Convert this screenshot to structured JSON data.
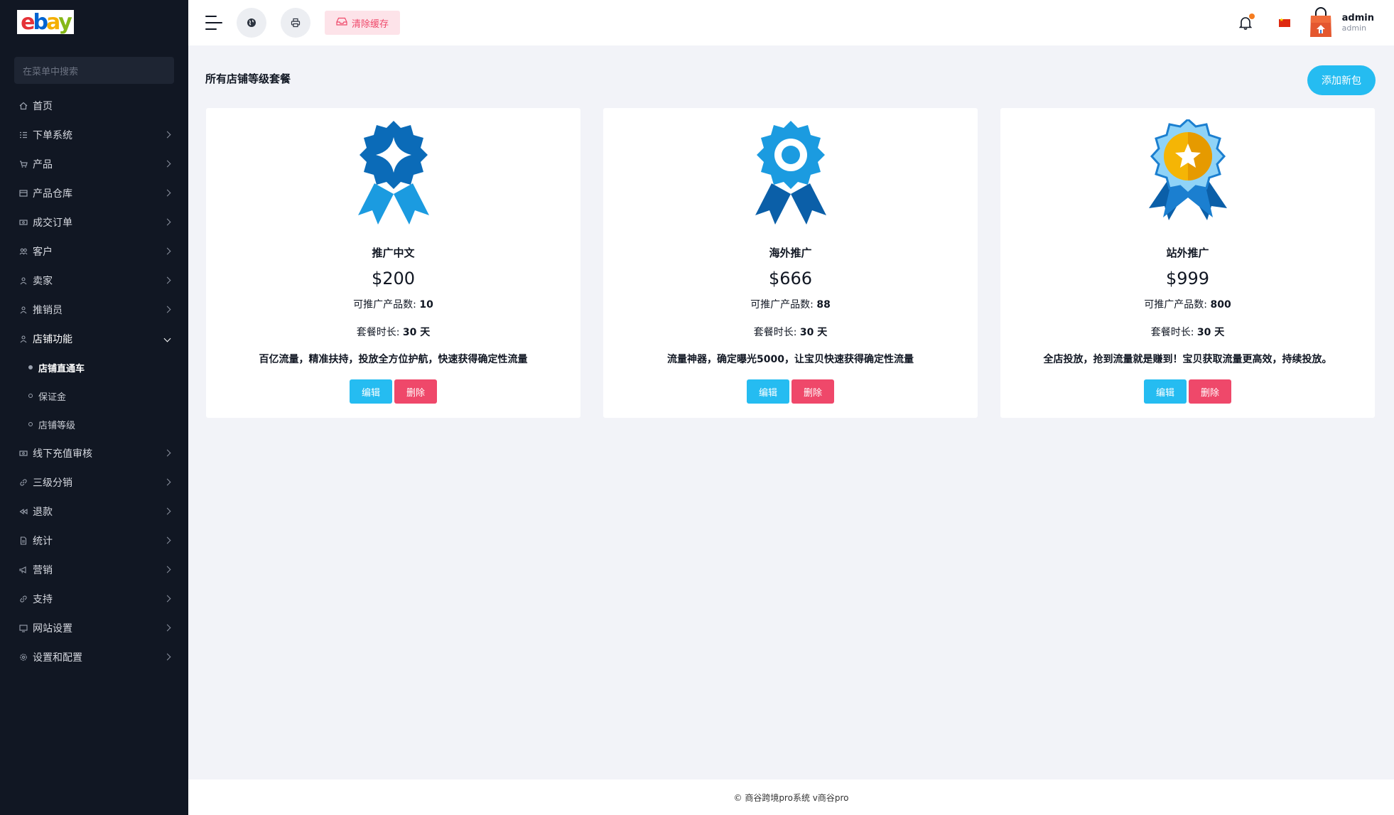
{
  "brand": {
    "logo_letters": [
      "e",
      "b",
      "a",
      "y"
    ]
  },
  "sidebar": {
    "search_placeholder": "在菜单中搜索",
    "items": [
      {
        "label": "首页",
        "icon": "home-icon",
        "has_children": false
      },
      {
        "label": "下单系统",
        "icon": "list-icon",
        "has_children": true
      },
      {
        "label": "产品",
        "icon": "cart-icon",
        "has_children": true
      },
      {
        "label": "产品仓库",
        "icon": "warehouse-icon",
        "has_children": true
      },
      {
        "label": "成交订单",
        "icon": "money-icon",
        "has_children": true
      },
      {
        "label": "客户",
        "icon": "users-icon",
        "has_children": true
      },
      {
        "label": "卖家",
        "icon": "user-icon",
        "has_children": true
      },
      {
        "label": "推销员",
        "icon": "user-icon",
        "has_children": true
      },
      {
        "label": "店铺功能",
        "icon": "user-icon",
        "has_children": true,
        "open": true
      }
    ],
    "sub_items": [
      {
        "label": "店铺直通车",
        "active": true
      },
      {
        "label": "保证金",
        "active": false
      },
      {
        "label": "店铺等级",
        "active": false
      }
    ],
    "items_after": [
      {
        "label": "线下充值审核",
        "icon": "money-icon"
      },
      {
        "label": "三级分销",
        "icon": "link-icon"
      },
      {
        "label": "退款",
        "icon": "rewind-icon"
      },
      {
        "label": "统计",
        "icon": "file-icon"
      },
      {
        "label": "营销",
        "icon": "megaphone-icon"
      },
      {
        "label": "支持",
        "icon": "link-icon"
      },
      {
        "label": "网站设置",
        "icon": "monitor-icon"
      },
      {
        "label": "设置和配置",
        "icon": "gear-icon"
      }
    ]
  },
  "topbar": {
    "clear_cache_label": "清除缓存",
    "user": {
      "name": "admin",
      "role": "admin"
    }
  },
  "main": {
    "page_title": "所有店铺等级套餐",
    "add_button_label": "添加新包",
    "packages": [
      {
        "name": "推广中文",
        "price": "$200",
        "products_label": "可推广产品数:",
        "products_value": "10",
        "duration_label": "套餐时长:",
        "duration_value": "30 天",
        "description": "百亿流量，精准扶持，投放全方位护航，快速获得确定性流量",
        "medal": "diamond-medal-icon",
        "edit_label": "编辑",
        "delete_label": "删除"
      },
      {
        "name": "海外推广",
        "price": "$666",
        "products_label": "可推广产品数:",
        "products_value": "88",
        "duration_label": "套餐时长:",
        "duration_value": "30 天",
        "description": "流量神器，确定曝光5000，让宝贝快速获得确定性流量",
        "medal": "circle-medal-icon",
        "edit_label": "编辑",
        "delete_label": "删除"
      },
      {
        "name": "站外推广",
        "price": "$999",
        "products_label": "可推广产品数:",
        "products_value": "800",
        "duration_label": "套餐时长:",
        "duration_value": "30 天",
        "description": "全店投放，抢到流量就是赚到！宝贝获取流量更高效，持续投放。",
        "medal": "star-medal-icon",
        "edit_label": "编辑",
        "delete_label": "删除"
      }
    ]
  },
  "footer": {
    "text": "© 商谷跨境pro系统 v商谷pro"
  }
}
